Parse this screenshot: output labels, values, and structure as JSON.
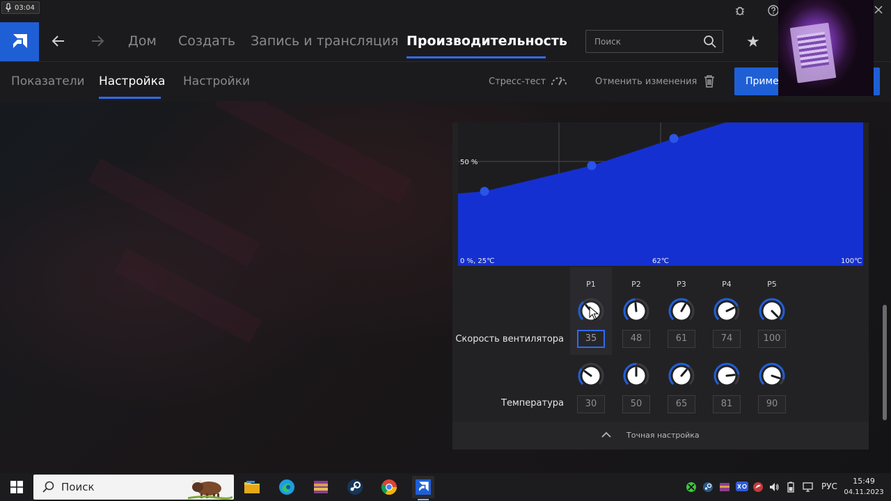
{
  "recorder": {
    "time": "03:04"
  },
  "nav": {
    "tabs": [
      {
        "label": "Дом"
      },
      {
        "label": "Создать"
      },
      {
        "label": "Запись и трансляция"
      },
      {
        "label": "Производительность"
      }
    ],
    "search_placeholder": "Поиск"
  },
  "subnav": {
    "tabs": [
      {
        "label": "Показатели"
      },
      {
        "label": "Настройка"
      },
      {
        "label": "Настройки"
      }
    ],
    "stress_test": "Стресс-тест",
    "revert": "Отменить изменения",
    "apply": "Примен"
  },
  "colors": {
    "accent": "#1f5fd6",
    "curve_fill": "#1530d0",
    "point": "#2a55e8"
  },
  "fan_curve": {
    "y_mid_label": "50 %",
    "origin_label": "0 %, 25℃",
    "x_mid_label": "62℃",
    "x_max_label": "100℃"
  },
  "points": {
    "headers": [
      "P1",
      "P2",
      "P3",
      "P4",
      "P5"
    ],
    "fan_label": "Скорость вентилятора",
    "temp_label": "Температура",
    "fan_speeds": [
      35,
      48,
      61,
      74,
      100
    ],
    "temperatures": [
      30,
      50,
      65,
      81,
      90
    ]
  },
  "fine_tune": {
    "label": "Точная настройка"
  },
  "taskbar": {
    "search_label": "Поиск",
    "lang": "РУС",
    "time": "15:49",
    "date": "04.11.2023"
  }
}
